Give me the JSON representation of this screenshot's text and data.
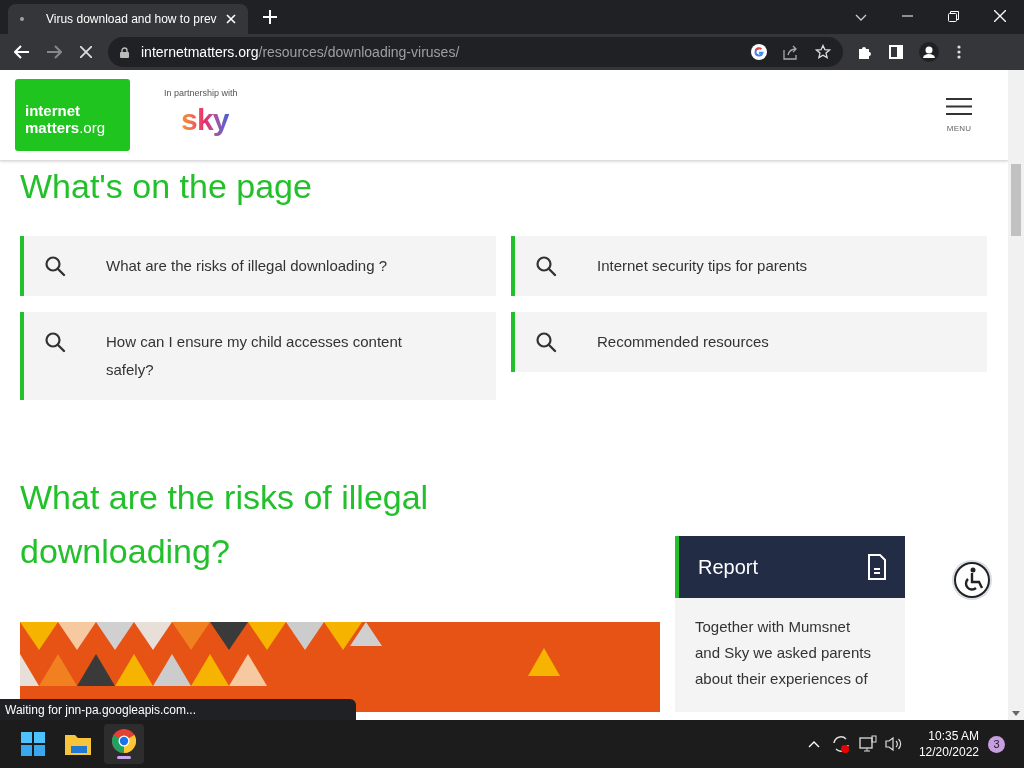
{
  "browser": {
    "tab": {
      "title": "Virus download and how to prev",
      "selected": true
    },
    "url_domain": "internetmatters.org",
    "url_path": "/resources/downloading-viruses/",
    "status": "Waiting for jnn-pa.googleapis.com..."
  },
  "header": {
    "logo_lines": [
      "internet",
      "matters",
      ".org"
    ],
    "partner_label": "In partnership with",
    "partner_logo": "sky",
    "menu_label": "MENU"
  },
  "contents": {
    "title": "What's on the page",
    "links": [
      {
        "label": "What are the risks of illegal downloading ?"
      },
      {
        "label": "Internet security tips for parents"
      },
      {
        "label": "How can I ensure my child accesses content safely?"
      },
      {
        "label": "Recommended resources"
      }
    ]
  },
  "section": {
    "title": "What are the risks of illegal downloading?"
  },
  "report": {
    "title": "Report",
    "text": "Together with Mumsnet and Sky we asked parents about their experiences of"
  },
  "taskbar": {
    "time": "10:35 AM",
    "date": "12/20/2022",
    "notification_count": "3"
  }
}
